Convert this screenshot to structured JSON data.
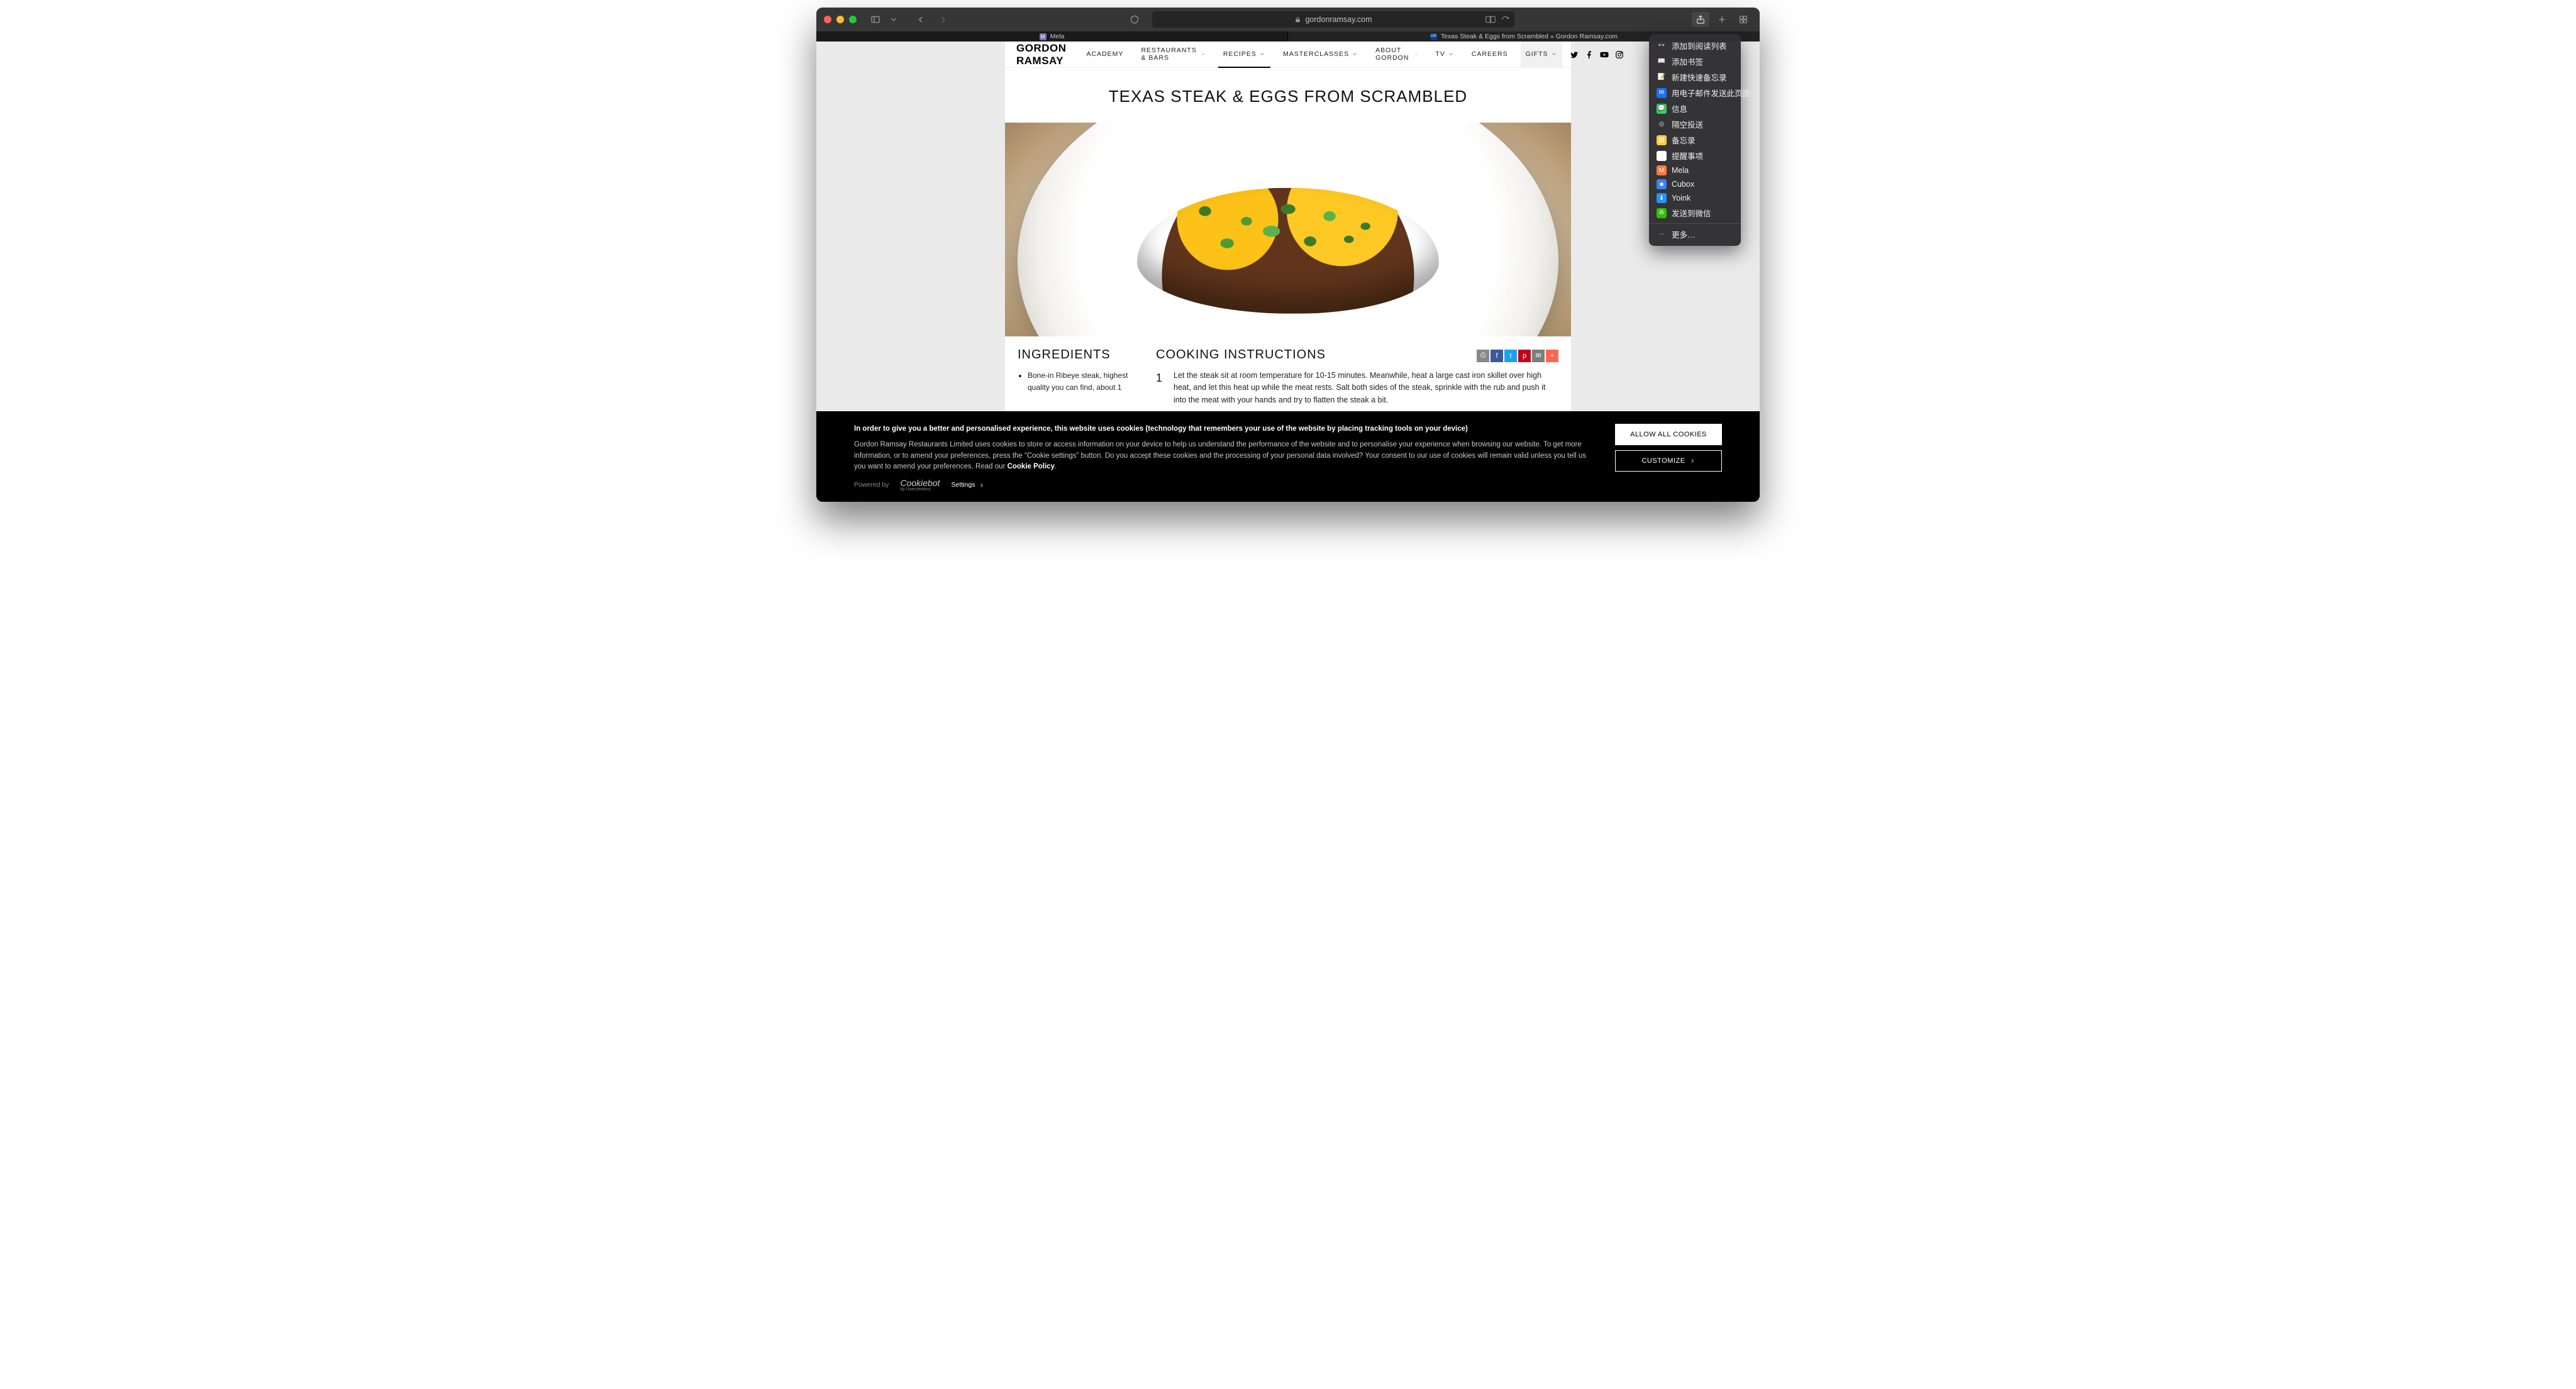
{
  "browser": {
    "url_host": "gordonramsay.com",
    "tabs": [
      {
        "favicon_label": "M",
        "favicon_bg": "#7b6fb1",
        "title": "Mela"
      },
      {
        "favicon_label": "GR",
        "favicon_bg": "#0a3a82",
        "title": "Texas Steak & Eggs from Scrambled » Gordon Ramsay.com"
      }
    ]
  },
  "share_menu": {
    "items": [
      {
        "icon": "glasses",
        "icon_bg": "transparent",
        "label": "添加到阅读列表"
      },
      {
        "icon": "book",
        "icon_bg": "transparent",
        "label": "添加书签"
      },
      {
        "icon": "note-new",
        "icon_bg": "transparent",
        "label": "新建快速备忘录"
      },
      {
        "icon": "mail",
        "icon_bg": "#1f6ff3",
        "label": "用电子邮件发送此页面"
      },
      {
        "icon": "messages",
        "icon_bg": "#30d158",
        "label": "信息"
      },
      {
        "icon": "airdrop",
        "icon_bg": "transparent",
        "label": "隔空投送"
      },
      {
        "icon": "notes",
        "icon_bg": "#f7c948",
        "label": "备忘录"
      },
      {
        "icon": "reminders",
        "icon_bg": "#ffffff",
        "label": "提醒事项"
      },
      {
        "icon": "mela",
        "icon_bg": "#ff7a3d",
        "label": "Mela"
      },
      {
        "icon": "cubox",
        "icon_bg": "#3b82f6",
        "label": "Cubox"
      },
      {
        "icon": "yoink",
        "icon_bg": "#2891ff",
        "label": "Yoink"
      },
      {
        "icon": "wechat",
        "icon_bg": "#2dc100",
        "label": "发送到微信"
      }
    ],
    "more_label": "更多…"
  },
  "site": {
    "logo": "GORDON RAMSAY",
    "nav": [
      {
        "label": "ACADEMY",
        "chevron": false,
        "active": false
      },
      {
        "label": "RESTAURANTS & BARS",
        "chevron": true,
        "active": false
      },
      {
        "label": "RECIPES",
        "chevron": true,
        "active": true
      },
      {
        "label": "MASTERCLASSES",
        "chevron": true,
        "active": false
      },
      {
        "label": "ABOUT GORDON",
        "chevron": true,
        "active": false
      },
      {
        "label": "TV",
        "chevron": true,
        "active": false
      },
      {
        "label": "CAREERS",
        "chevron": false,
        "active": false
      },
      {
        "label": "GIFTS",
        "chevron": true,
        "active": false,
        "highlight": true
      }
    ],
    "page_title": "TEXAS STEAK & EGGS FROM SCRAMBLED",
    "ingredients_heading": "INGREDIENTS",
    "ingredients": [
      "Bone-in Ribeye steak, highest quality you can find, about 1"
    ],
    "cooking_heading": "COOKING INSTRUCTIONS",
    "share_buttons": [
      {
        "name": "print",
        "bg": "#888888",
        "glyph": "⎙"
      },
      {
        "name": "facebook",
        "bg": "#3b5998",
        "glyph": "f"
      },
      {
        "name": "twitter",
        "bg": "#1da1f2",
        "glyph": "t"
      },
      {
        "name": "pinterest",
        "bg": "#bd081c",
        "glyph": "p"
      },
      {
        "name": "email",
        "bg": "#7d7d7d",
        "glyph": "✉"
      },
      {
        "name": "more",
        "bg": "#ff6550",
        "glyph": "+"
      }
    ],
    "steps": [
      {
        "num": "1",
        "text": "Let the steak sit at room temperature for 10-15 minutes. Meanwhile, heat a large cast iron skillet over high heat, and let this heat up while the meat rests. Salt both sides of the steak, sprinkle with the rub and push it into the meat with your hands and try to flatten the steak a bit."
      }
    ]
  },
  "cookie": {
    "bold_lead": "In order to give you a better and personalised experience, this website uses cookies (technology that remembers your use of the website by placing tracking tools on your device)",
    "body": "Gordon Ramsay Restaurants Limited uses cookies to store or access information on your device to help us understand the performance of the website and to personalise your experience when browsing our website. To get more information, or to amend your preferences, press the “Cookie settings” button. Do you accept these cookies and the processing of your personal data involved? Your consent to our use of cookies will remain valid unless you tell us you want to amend your preferences. Read our ",
    "policy_link": "Cookie Policy",
    "allow_label": "ALLOW ALL COOKIES",
    "customize_label": "CUSTOMIZE",
    "powered_by": "Powered by",
    "provider": "Cookiebot",
    "provider_sub": "by Usercentrics",
    "settings_label": "Settings"
  }
}
